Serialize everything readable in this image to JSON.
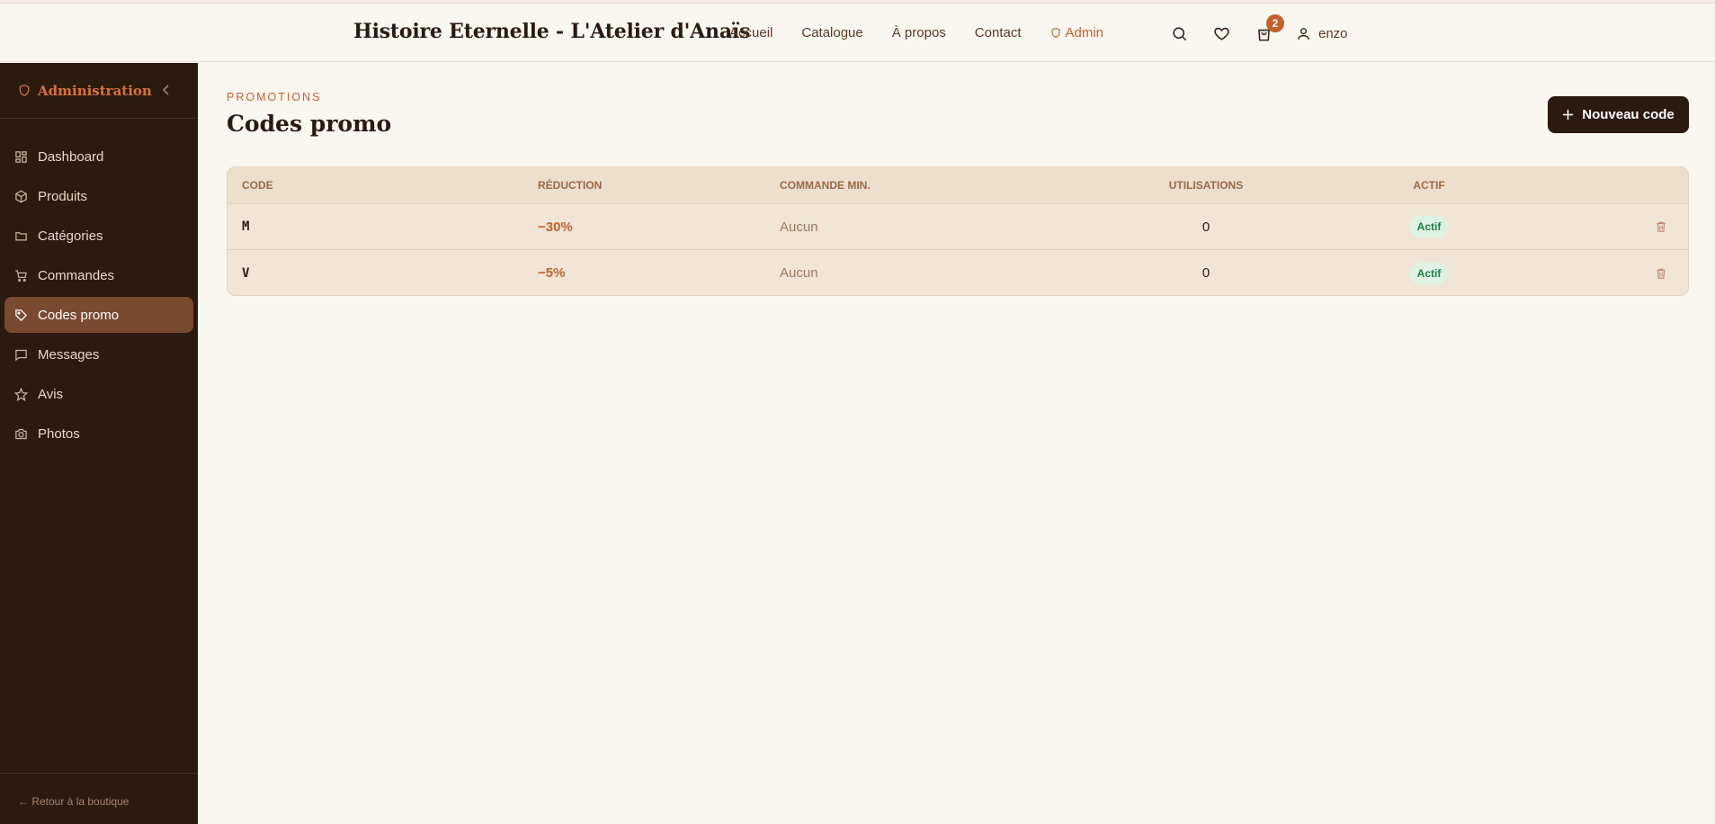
{
  "header": {
    "brand": "Histoire Eternelle - L'Atelier d'Anaïs",
    "nav": [
      "Accueil",
      "Catalogue",
      "À propos",
      "Contact",
      "Admin"
    ],
    "cart_count": "2",
    "user_name": "enzo"
  },
  "sidebar": {
    "title": "Administration",
    "items": [
      {
        "label": "Dashboard",
        "icon": "dashboard-icon"
      },
      {
        "label": "Produits",
        "icon": "package-icon"
      },
      {
        "label": "Catégories",
        "icon": "folder-icon"
      },
      {
        "label": "Commandes",
        "icon": "cart-icon"
      },
      {
        "label": "Codes promo",
        "icon": "tag-icon",
        "active": true
      },
      {
        "label": "Messages",
        "icon": "message-icon"
      },
      {
        "label": "Avis",
        "icon": "star-icon"
      },
      {
        "label": "Photos",
        "icon": "camera-icon"
      }
    ],
    "footer": "← Retour à la boutique"
  },
  "main": {
    "eyebrow": "PROMOTIONS",
    "title": "Codes promo",
    "new_button": "Nouveau code",
    "table": {
      "headers": [
        "CODE",
        "RÉDUCTION",
        "COMMANDE MIN.",
        "UTILISATIONS",
        "ACTIF"
      ],
      "rows": [
        {
          "code": "M",
          "reduction": "−30%",
          "min": "Aucun",
          "uses": "0",
          "active": "Actif"
        },
        {
          "code": "V",
          "reduction": "−5%",
          "min": "Aucun",
          "uses": "0",
          "active": "Actif"
        }
      ]
    }
  },
  "colors": {
    "accent": "#c2622e",
    "sidebar_bg": "#2b1a10",
    "page_bg": "#faf6f0",
    "active_item": "#7a4a30"
  }
}
